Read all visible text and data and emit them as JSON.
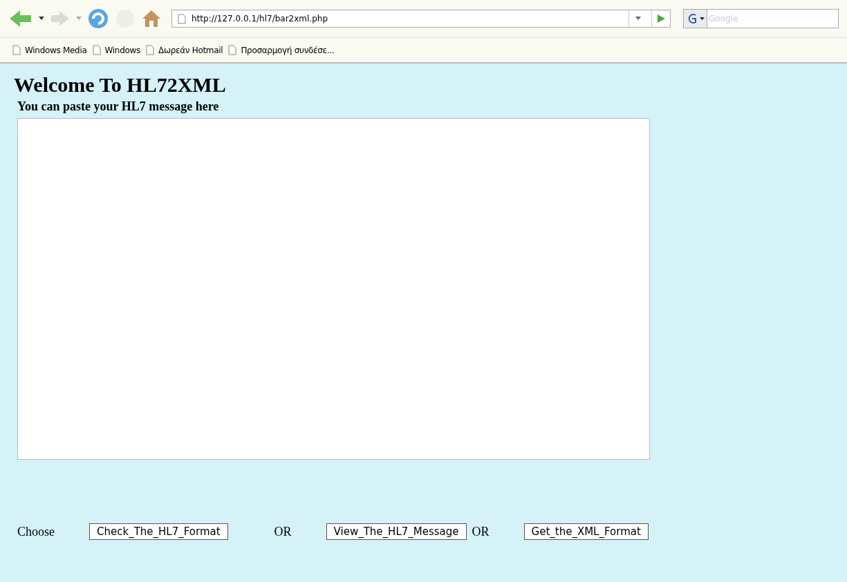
{
  "toolbar": {
    "address": "http://127.0.0.1/hl7/bar2xml.php",
    "search_placeholder": "Google"
  },
  "bookmarks": [
    "Windows Media",
    "Windows",
    "Δωρεάν Hotmail",
    "Προσαρμογή συνδέσε..."
  ],
  "page": {
    "title": "Welcome To HL72XML",
    "subtitle": "You can paste your HL7 message here",
    "actions": [
      {
        "kind": "label",
        "text": "Choose"
      },
      {
        "kind": "button",
        "text": "Check_The_HL7_Format"
      },
      {
        "kind": "label",
        "text": "OR"
      },
      {
        "kind": "button",
        "text": "View_The_HL7_Message"
      },
      {
        "kind": "label",
        "text": "OR"
      },
      {
        "kind": "button",
        "text": "Get_the_XML_Format"
      }
    ]
  }
}
